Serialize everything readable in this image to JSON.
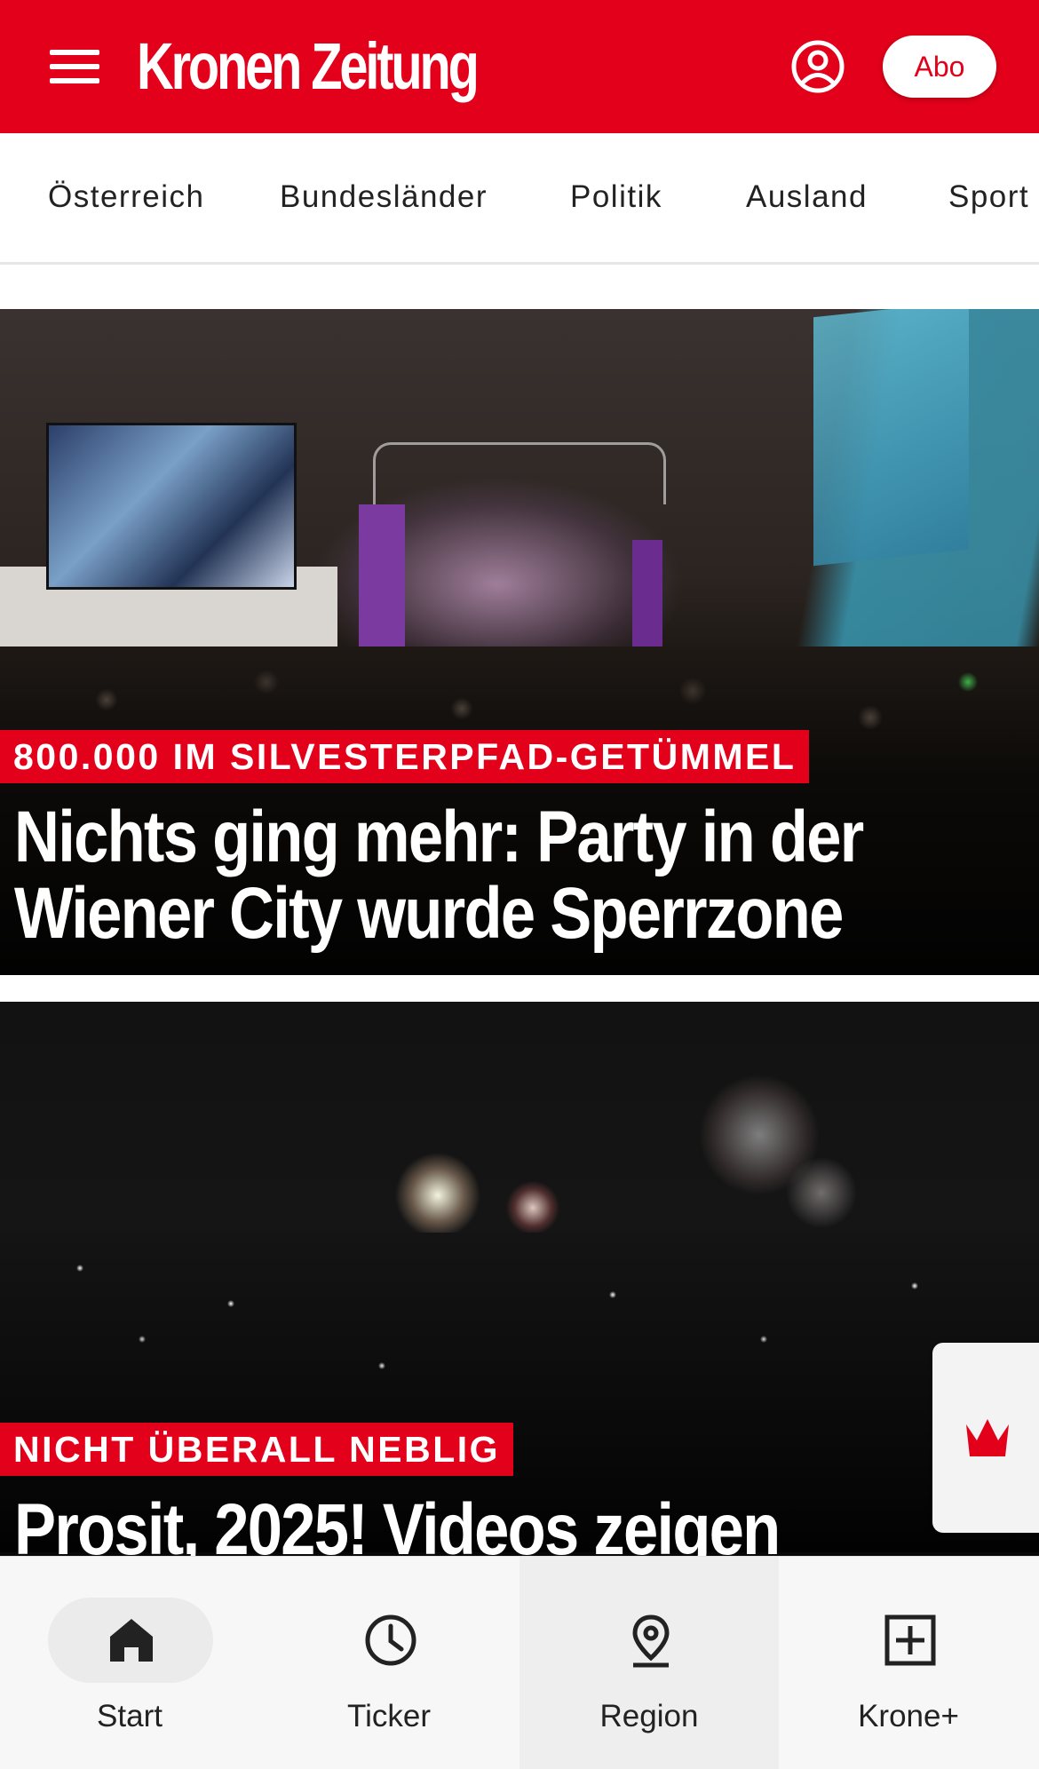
{
  "header": {
    "logo_text": "Kronen Zeitung",
    "abo_label": "Abo",
    "brand_color": "#e2001a"
  },
  "nav": {
    "categories": [
      "Österreich",
      "Bundesländer",
      "Politik",
      "Ausland",
      "Sport"
    ]
  },
  "articles": [
    {
      "kicker": "800.000 IM SILVESTERPFAD-GETÜMMEL",
      "headline_line1": "Nichts ging mehr: Party in der",
      "headline_line2": "Wiener City wurde Sperrzone",
      "image_icon": "photo-crowd-concert"
    },
    {
      "kicker": "NICHT ÜBERALL NEBLIG",
      "headline_line1": "Prosit, 2025! Videos zeigen",
      "image_icon": "photo-fireworks"
    }
  ],
  "float_button": {
    "icon": "crown-icon"
  },
  "tabbar": {
    "tabs": [
      {
        "label": "Start",
        "icon": "home-icon"
      },
      {
        "label": "Ticker",
        "icon": "clock-icon"
      },
      {
        "label": "Region",
        "icon": "location-pin-icon"
      },
      {
        "label": "Krone+",
        "icon": "plus-box-icon"
      }
    ]
  }
}
